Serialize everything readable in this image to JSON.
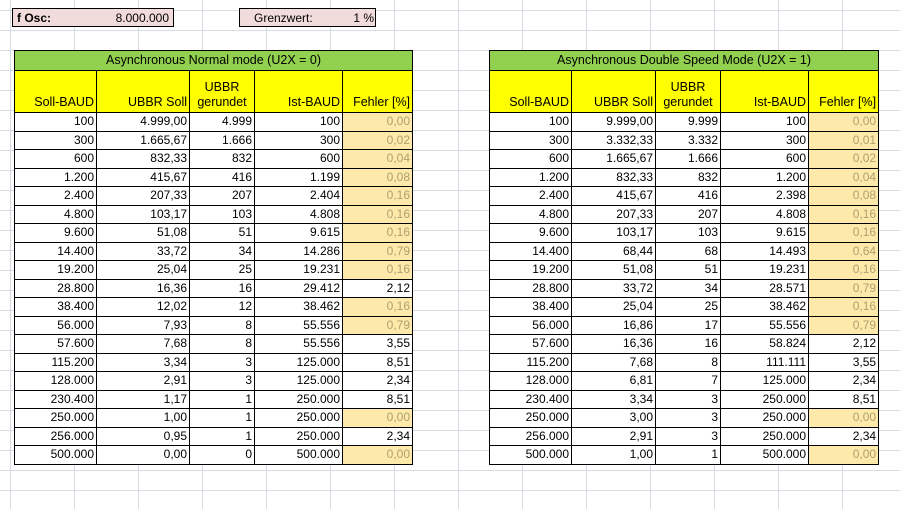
{
  "osc": {
    "label": "f Osc:",
    "value": "8.000.000"
  },
  "limit": {
    "label": "Grenzwert:",
    "value": "1 %"
  },
  "colors": {
    "title_bg": "#92d050",
    "header_bg": "#ffff00",
    "warn_bg": "#fde9a9",
    "osc_bg": "#f2dcdb"
  },
  "tables": [
    {
      "title": "Asynchronous Normal mode (U2X = 0)",
      "headers": [
        "Soll-BAUD",
        "UBBR Soll",
        "UBBR gerundet",
        "Ist-BAUD",
        "Fehler [%]"
      ],
      "rows": [
        [
          "100",
          "4.999,00",
          "4.999",
          "100",
          "0,00"
        ],
        [
          "300",
          "1.665,67",
          "1.666",
          "300",
          "0,02"
        ],
        [
          "600",
          "832,33",
          "832",
          "600",
          "0,04"
        ],
        [
          "1.200",
          "415,67",
          "416",
          "1.199",
          "0,08"
        ],
        [
          "2.400",
          "207,33",
          "207",
          "2.404",
          "0,16"
        ],
        [
          "4.800",
          "103,17",
          "103",
          "4.808",
          "0,16"
        ],
        [
          "9.600",
          "51,08",
          "51",
          "9.615",
          "0,16"
        ],
        [
          "14.400",
          "33,72",
          "34",
          "14.286",
          "0,79"
        ],
        [
          "19.200",
          "25,04",
          "25",
          "19.231",
          "0,16"
        ],
        [
          "28.800",
          "16,36",
          "16",
          "29.412",
          "2,12"
        ],
        [
          "38.400",
          "12,02",
          "12",
          "38.462",
          "0,16"
        ],
        [
          "56.000",
          "7,93",
          "8",
          "55.556",
          "0,79"
        ],
        [
          "57.600",
          "7,68",
          "8",
          "55.556",
          "3,55"
        ],
        [
          "115.200",
          "3,34",
          "3",
          "125.000",
          "8,51"
        ],
        [
          "128.000",
          "2,91",
          "3",
          "125.000",
          "2,34"
        ],
        [
          "230.400",
          "1,17",
          "1",
          "250.000",
          "8,51"
        ],
        [
          "250.000",
          "1,00",
          "1",
          "250.000",
          "0,00"
        ],
        [
          "256.000",
          "0,95",
          "1",
          "250.000",
          "2,34"
        ],
        [
          "500.000",
          "0,00",
          "0",
          "500.000",
          "0,00"
        ]
      ]
    },
    {
      "title": "Asynchronous Double Speed Mode (U2X = 1)",
      "headers": [
        "Soll-BAUD",
        "UBBR Soll",
        "UBBR gerundet",
        "Ist-BAUD",
        "Fehler [%]"
      ],
      "rows": [
        [
          "100",
          "9.999,00",
          "9.999",
          "100",
          "0,00"
        ],
        [
          "300",
          "3.332,33",
          "3.332",
          "300",
          "0,01"
        ],
        [
          "600",
          "1.665,67",
          "1.666",
          "600",
          "0,02"
        ],
        [
          "1.200",
          "832,33",
          "832",
          "1.200",
          "0,04"
        ],
        [
          "2.400",
          "415,67",
          "416",
          "2.398",
          "0,08"
        ],
        [
          "4.800",
          "207,33",
          "207",
          "4.808",
          "0,16"
        ],
        [
          "9.600",
          "103,17",
          "103",
          "9.615",
          "0,16"
        ],
        [
          "14.400",
          "68,44",
          "68",
          "14.493",
          "0,64"
        ],
        [
          "19.200",
          "51,08",
          "51",
          "19.231",
          "0,16"
        ],
        [
          "28.800",
          "33,72",
          "34",
          "28.571",
          "0,79"
        ],
        [
          "38.400",
          "25,04",
          "25",
          "38.462",
          "0,16"
        ],
        [
          "56.000",
          "16,86",
          "17",
          "55.556",
          "0,79"
        ],
        [
          "57.600",
          "16,36",
          "16",
          "58.824",
          "2,12"
        ],
        [
          "115.200",
          "7,68",
          "8",
          "111.111",
          "3,55"
        ],
        [
          "128.000",
          "6,81",
          "7",
          "125.000",
          "2,34"
        ],
        [
          "230.400",
          "3,34",
          "3",
          "250.000",
          "8,51"
        ],
        [
          "250.000",
          "3,00",
          "3",
          "250.000",
          "0,00"
        ],
        [
          "256.000",
          "2,91",
          "3",
          "250.000",
          "2,34"
        ],
        [
          "500.000",
          "1,00",
          "1",
          "500.000",
          "0,00"
        ]
      ]
    }
  ]
}
